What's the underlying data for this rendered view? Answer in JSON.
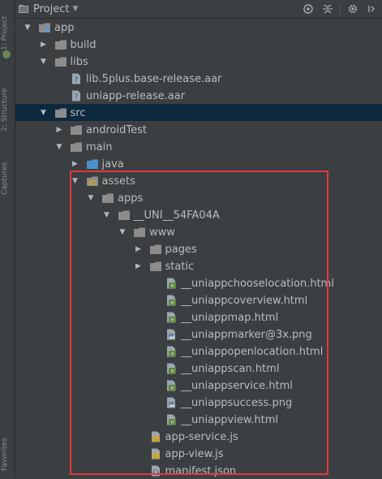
{
  "sidebar": {
    "labels": [
      "1: Project",
      "2: Structure",
      "Captures",
      "Favorites"
    ]
  },
  "header": {
    "title": "Project",
    "tools": [
      "target-icon",
      "collapse-icon",
      "gear-icon",
      "hide-icon"
    ]
  },
  "tree": {
    "items": [
      {
        "label": "app",
        "depth": 0,
        "expanded": true,
        "has_arrow": true,
        "icon": "module-folder-icon",
        "selected": false
      },
      {
        "label": "build",
        "depth": 1,
        "expanded": false,
        "has_arrow": true,
        "icon": "folder-icon",
        "selected": false
      },
      {
        "label": "libs",
        "depth": 1,
        "expanded": true,
        "has_arrow": true,
        "icon": "folder-icon",
        "selected": false
      },
      {
        "label": "lib.5plus.base-release.aar",
        "depth": 2,
        "expanded": false,
        "has_arrow": false,
        "icon": "unknown-file-icon",
        "selected": false
      },
      {
        "label": "uniapp-release.aar",
        "depth": 2,
        "expanded": false,
        "has_arrow": false,
        "icon": "unknown-file-icon",
        "selected": false
      },
      {
        "label": "src",
        "depth": 1,
        "expanded": true,
        "has_arrow": true,
        "icon": "folder-icon",
        "selected": true
      },
      {
        "label": "androidTest",
        "depth": 2,
        "expanded": false,
        "has_arrow": true,
        "icon": "folder-icon",
        "selected": false
      },
      {
        "label": "main",
        "depth": 2,
        "expanded": true,
        "has_arrow": true,
        "icon": "folder-icon",
        "selected": false
      },
      {
        "label": "java",
        "depth": 3,
        "expanded": false,
        "has_arrow": true,
        "icon": "source-folder-icon",
        "selected": false
      },
      {
        "label": "assets",
        "depth": 3,
        "expanded": true,
        "has_arrow": true,
        "icon": "resource-folder-icon",
        "selected": false
      },
      {
        "label": "apps",
        "depth": 4,
        "expanded": true,
        "has_arrow": true,
        "icon": "folder-icon",
        "selected": false
      },
      {
        "label": "__UNI__54FA04A",
        "depth": 5,
        "expanded": true,
        "has_arrow": true,
        "icon": "folder-icon",
        "selected": false
      },
      {
        "label": "www",
        "depth": 6,
        "expanded": true,
        "has_arrow": true,
        "icon": "folder-icon",
        "selected": false
      },
      {
        "label": "pages",
        "depth": 7,
        "expanded": false,
        "has_arrow": true,
        "icon": "folder-icon",
        "selected": false
      },
      {
        "label": "static",
        "depth": 7,
        "expanded": false,
        "has_arrow": true,
        "icon": "folder-icon",
        "selected": false
      },
      {
        "label": "__uniappchooselocation.html",
        "depth": 8,
        "expanded": false,
        "has_arrow": false,
        "icon": "html-file-icon",
        "selected": false
      },
      {
        "label": "__uniappcoverview.html",
        "depth": 8,
        "expanded": false,
        "has_arrow": false,
        "icon": "html-file-icon",
        "selected": false
      },
      {
        "label": "__uniappmap.html",
        "depth": 8,
        "expanded": false,
        "has_arrow": false,
        "icon": "html-file-icon",
        "selected": false
      },
      {
        "label": "__uniappmarker@3x.png",
        "depth": 8,
        "expanded": false,
        "has_arrow": false,
        "icon": "image-file-icon",
        "selected": false
      },
      {
        "label": "__uniappopenlocation.html",
        "depth": 8,
        "expanded": false,
        "has_arrow": false,
        "icon": "html-file-icon",
        "selected": false
      },
      {
        "label": "__uniappscan.html",
        "depth": 8,
        "expanded": false,
        "has_arrow": false,
        "icon": "html-file-icon",
        "selected": false
      },
      {
        "label": "__uniappservice.html",
        "depth": 8,
        "expanded": false,
        "has_arrow": false,
        "icon": "html-file-icon",
        "selected": false
      },
      {
        "label": "__uniappsuccess.png",
        "depth": 8,
        "expanded": false,
        "has_arrow": false,
        "icon": "image-file-icon",
        "selected": false
      },
      {
        "label": "__uniappview.html",
        "depth": 8,
        "expanded": false,
        "has_arrow": false,
        "icon": "html-file-icon",
        "selected": false
      },
      {
        "label": "app-service.js",
        "depth": 7,
        "expanded": false,
        "has_arrow": false,
        "icon": "js-file-icon",
        "selected": false
      },
      {
        "label": "app-view.js",
        "depth": 7,
        "expanded": false,
        "has_arrow": false,
        "icon": "js-file-icon",
        "selected": false
      },
      {
        "label": "manifest.json",
        "depth": 7,
        "expanded": false,
        "has_arrow": false,
        "icon": "json-file-icon",
        "selected": false
      }
    ]
  },
  "colors": {
    "background": "#3c3f41",
    "selection": "#0d293e",
    "highlight_border": "#e0393e",
    "folder": "#8c8c8c",
    "source_folder": "#4a90c8",
    "html": "#6a8759",
    "js": "#c9a33f"
  }
}
